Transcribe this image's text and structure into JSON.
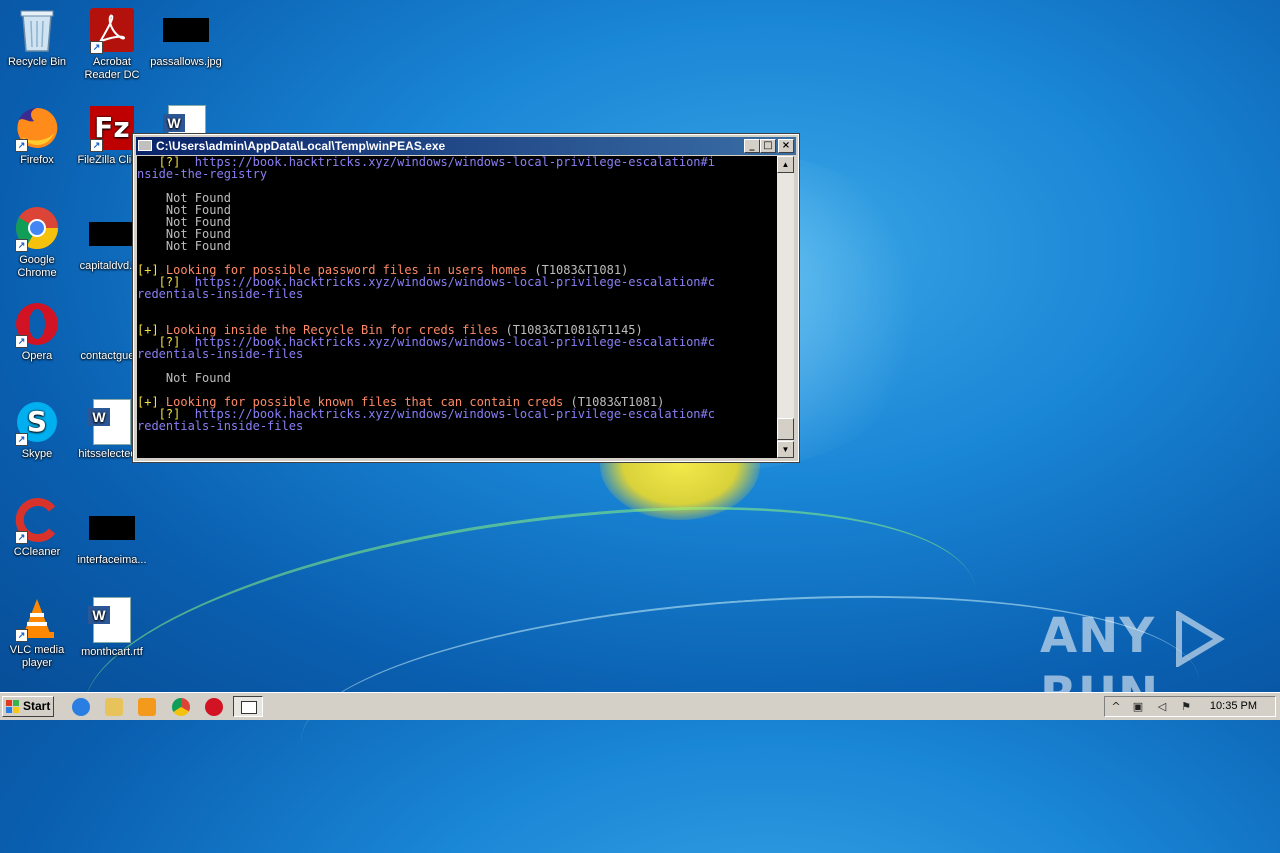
{
  "desktop": {
    "icons": [
      {
        "label": "Recycle Bin"
      },
      {
        "label": "Acrobat Reader DC"
      },
      {
        "label": "passallows.jpg"
      },
      {
        "label": "Firefox"
      },
      {
        "label": "FileZilla Clie..."
      },
      {
        "label": "Google Chrome"
      },
      {
        "label": "capitaldvd.r..."
      },
      {
        "label": "Opera"
      },
      {
        "label": "contactgue..."
      },
      {
        "label": "Skype"
      },
      {
        "label": "hitsselected..."
      },
      {
        "label": "CCleaner"
      },
      {
        "label": "interfaceima..."
      },
      {
        "label": "VLC media player"
      },
      {
        "label": "monthcart.rtf"
      }
    ]
  },
  "window": {
    "title": "C:\\Users\\admin\\AppData\\Local\\Temp\\winPEAS.exe",
    "minimize": "_",
    "maximize": "□",
    "close": "×"
  },
  "console": {
    "lines": [
      {
        "text": "   [?]  https://book.hacktricks.xyz/windows/windows-local-privilege-escalation#i",
        "style": "link"
      },
      {
        "text": "nside-the-registry",
        "style": "link"
      },
      {
        "text": "",
        "style": "white"
      },
      {
        "text": "    Not Found",
        "style": "gray"
      },
      {
        "text": "    Not Found",
        "style": "gray"
      },
      {
        "text": "    Not Found",
        "style": "gray"
      },
      {
        "text": "    Not Found",
        "style": "gray"
      },
      {
        "text": "    Not Found",
        "style": "gray"
      },
      {
        "text": "",
        "style": "white"
      },
      {
        "text": "[+] Looking for possible password files in users homes (T1083&T1081)",
        "style": "section"
      },
      {
        "text": "   [?]  https://book.hacktricks.xyz/windows/windows-local-privilege-escalation#c",
        "style": "link"
      },
      {
        "text": "redentials-inside-files",
        "style": "link"
      },
      {
        "text": "",
        "style": "white"
      },
      {
        "text": "",
        "style": "white"
      },
      {
        "text": "[+] Looking inside the Recycle Bin for creds files (T1083&T1081&T1145)",
        "style": "section"
      },
      {
        "text": "   [?]  https://book.hacktricks.xyz/windows/windows-local-privilege-escalation#c",
        "style": "link"
      },
      {
        "text": "redentials-inside-files",
        "style": "link"
      },
      {
        "text": "",
        "style": "white"
      },
      {
        "text": "    Not Found",
        "style": "gray"
      },
      {
        "text": "",
        "style": "white"
      },
      {
        "text": "[+] Looking for possible known files that can contain creds (T1083&T1081)",
        "style": "section"
      },
      {
        "text": "   [?]  https://book.hacktricks.xyz/windows/windows-local-privilege-escalation#c",
        "style": "link"
      },
      {
        "text": "redentials-inside-files",
        "style": "link"
      }
    ]
  },
  "watermark": {
    "left": "ANY",
    "right": "RUN"
  },
  "taskbar": {
    "start_label": "Start",
    "clock": "10:35 PM"
  },
  "colors": {
    "section": "#ff8a65",
    "bracket": "#f0e040",
    "link": "#8a7ff5",
    "gray": "#bdbdbd"
  }
}
